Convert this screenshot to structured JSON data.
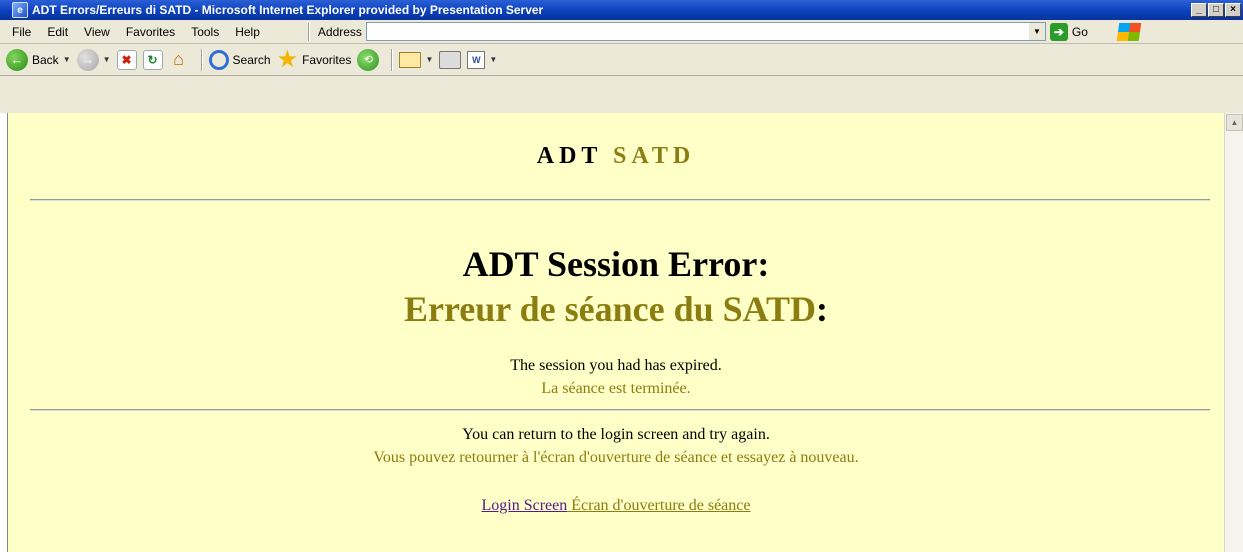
{
  "window": {
    "title": "ADT Errors/Erreurs di SATD - Microsoft Internet Explorer provided by Presentation Server",
    "min_label": "_",
    "max_label": "□",
    "close_label": "×"
  },
  "menu": {
    "items": [
      "File",
      "Edit",
      "View",
      "Favorites",
      "Tools",
      "Help"
    ],
    "address_label": "Address",
    "address_value": "",
    "go_label": "Go"
  },
  "toolbar": {
    "back_label": "Back",
    "search_label": "Search",
    "favorites_label": "Favorites"
  },
  "page": {
    "header_en": "ADT",
    "header_fr": "SATD",
    "error_title_en": "ADT Session Error:",
    "error_title_fr": "Erreur de séance du SATD",
    "error_title_fr_colon": ":",
    "message_en": "The session you had has expired.",
    "message_fr": "La séance est terminée.",
    "return_en": "You can return to the login screen and try again.",
    "return_fr": "Vous pouvez retourner à l'écran d'ouverture de séance et essayez à nouveau.",
    "link_en": "Login Screen",
    "link_fr": "Écran d'ouverture de séance"
  },
  "colors": {
    "page_background": "#ffffc8",
    "french_text": "#8b7d10",
    "visited_link": "#551a8b",
    "titlebar": "#0a3fb9"
  }
}
